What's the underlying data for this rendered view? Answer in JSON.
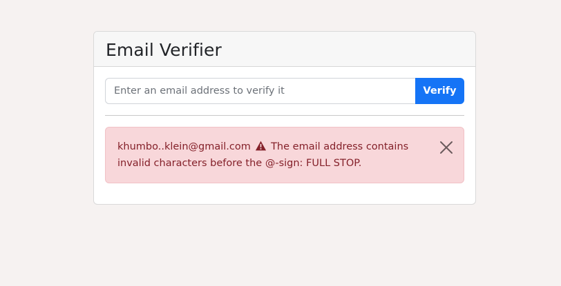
{
  "card": {
    "title": "Email Verifier"
  },
  "form": {
    "input_value": "",
    "input_placeholder": "Enter an email address to verify it",
    "verify_label": "Verify"
  },
  "alert": {
    "email": "khumbo..klein@gmail.com",
    "icon": "warning-triangle-icon",
    "message": "The email address contains invalid characters before the @-sign: FULL STOP.",
    "close_icon": "close-icon"
  },
  "colors": {
    "page_background": "#f6f2f1",
    "button_primary": "#1574f6",
    "alert_background": "#f8d7da",
    "alert_text": "#842029"
  }
}
